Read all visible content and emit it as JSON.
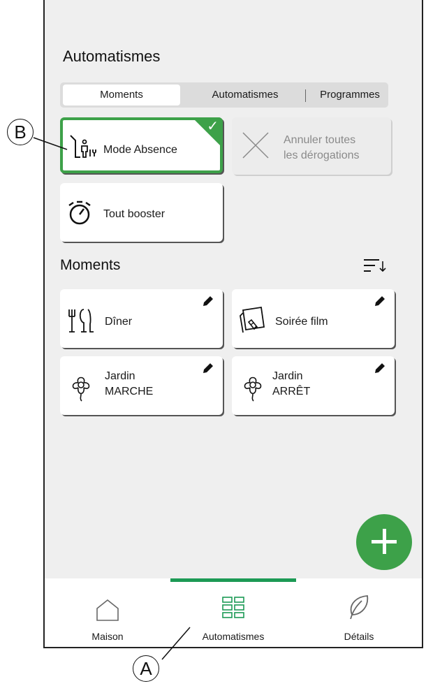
{
  "header": {
    "title": "Automatismes"
  },
  "tabs": [
    {
      "label": "Moments",
      "active": true
    },
    {
      "label": "Automatismes",
      "active": false
    },
    {
      "label": "Programmes",
      "active": false
    }
  ],
  "quick_actions": {
    "absence": {
      "label": "Mode Absence",
      "selected": true,
      "icon": "away-person-icon"
    },
    "cancel": {
      "line1": "Annuler toutes",
      "line2": "les dérogations",
      "disabled": true,
      "icon": "close-x-icon"
    },
    "boost": {
      "label": "Tout booster",
      "icon": "stopwatch-icon"
    }
  },
  "moments": {
    "title": "Moments",
    "sort_icon": "sort-icon",
    "items": [
      {
        "line1": "Dîner",
        "line2": "",
        "icon": "dining-icon"
      },
      {
        "line1": "Soirée film",
        "line2": "",
        "icon": "tv-remote-icon"
      },
      {
        "line1": "Jardin",
        "line2": "MARCHE",
        "icon": "flower-icon"
      },
      {
        "line1": "Jardin",
        "line2": "ARRÊT",
        "icon": "flower-icon"
      }
    ]
  },
  "fab": {
    "icon": "plus-icon"
  },
  "bottom_nav": [
    {
      "label": "Maison",
      "icon": "house-icon",
      "active": false
    },
    {
      "label": "Automatismes",
      "icon": "grid-icon",
      "active": true
    },
    {
      "label": "Détails",
      "icon": "leaf-icon",
      "active": false
    }
  ],
  "callouts": {
    "a": "A",
    "b": "B"
  },
  "colors": {
    "accent": "#3da149",
    "nav_indicator": "#1c9a55",
    "background": "#efefef"
  }
}
